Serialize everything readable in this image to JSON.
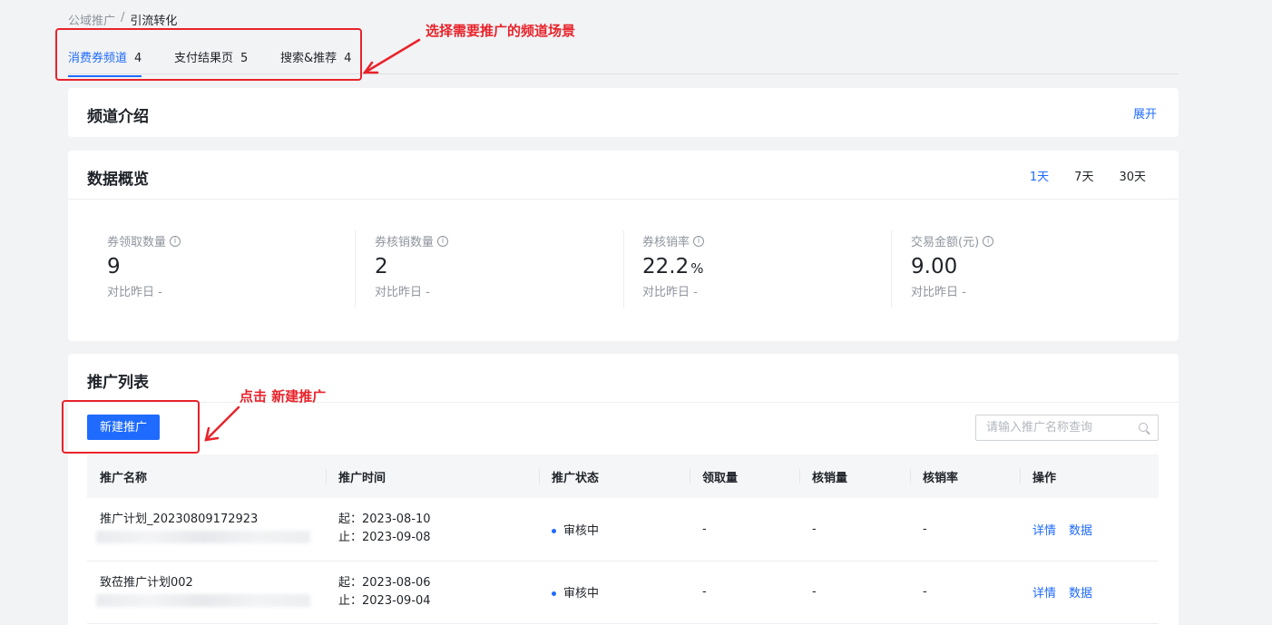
{
  "breadcrumb": {
    "root": "公域推广",
    "separator": "/",
    "current": "引流转化"
  },
  "tabs": [
    {
      "label": "消费券频道",
      "count": "4",
      "active": true
    },
    {
      "label": "支付结果页",
      "count": "5",
      "active": false
    },
    {
      "label": "搜索&推荐",
      "count": "4",
      "active": false
    }
  ],
  "intro": {
    "title": "频道介绍",
    "expand_label": "展开"
  },
  "overview": {
    "title": "数据概览",
    "ranges": [
      "1天",
      "7天",
      "30天"
    ],
    "active_range": "1天",
    "metrics": [
      {
        "label": "券领取数量",
        "value": "9",
        "unit": "",
        "compare": "对比昨日 -"
      },
      {
        "label": "券核销数量",
        "value": "2",
        "unit": "",
        "compare": "对比昨日 -"
      },
      {
        "label": "券核销率",
        "value": "22.2",
        "unit": "%",
        "compare": "对比昨日 -"
      },
      {
        "label": "交易金额(元)",
        "value": "9.00",
        "unit": "",
        "compare": "对比昨日 -"
      }
    ]
  },
  "list": {
    "title": "推广列表",
    "new_button": "新建推广",
    "search_placeholder": "请输入推广名称查询",
    "columns": [
      "推广名称",
      "推广时间",
      "推广状态",
      "领取量",
      "核销量",
      "核销率",
      "操作"
    ],
    "rows": [
      {
        "name": "推广计划_20230809172923",
        "start": "起：2023-08-10",
        "end": "止：2023-09-08",
        "status": "审核中",
        "claimed": "-",
        "redeemed": "-",
        "rate": "-",
        "op_detail": "详情",
        "op_data": "数据"
      },
      {
        "name": "致莅推广计划002",
        "start": "起：2023-08-06",
        "end": "止：2023-09-04",
        "status": "审核中",
        "claimed": "-",
        "redeemed": "-",
        "rate": "-",
        "op_detail": "详情",
        "op_data": "数据"
      }
    ]
  },
  "annotations": {
    "tabs_hint": "选择需要推广的频道场景",
    "new_hint": "点击 新建推广",
    "color": "#e8232b"
  }
}
